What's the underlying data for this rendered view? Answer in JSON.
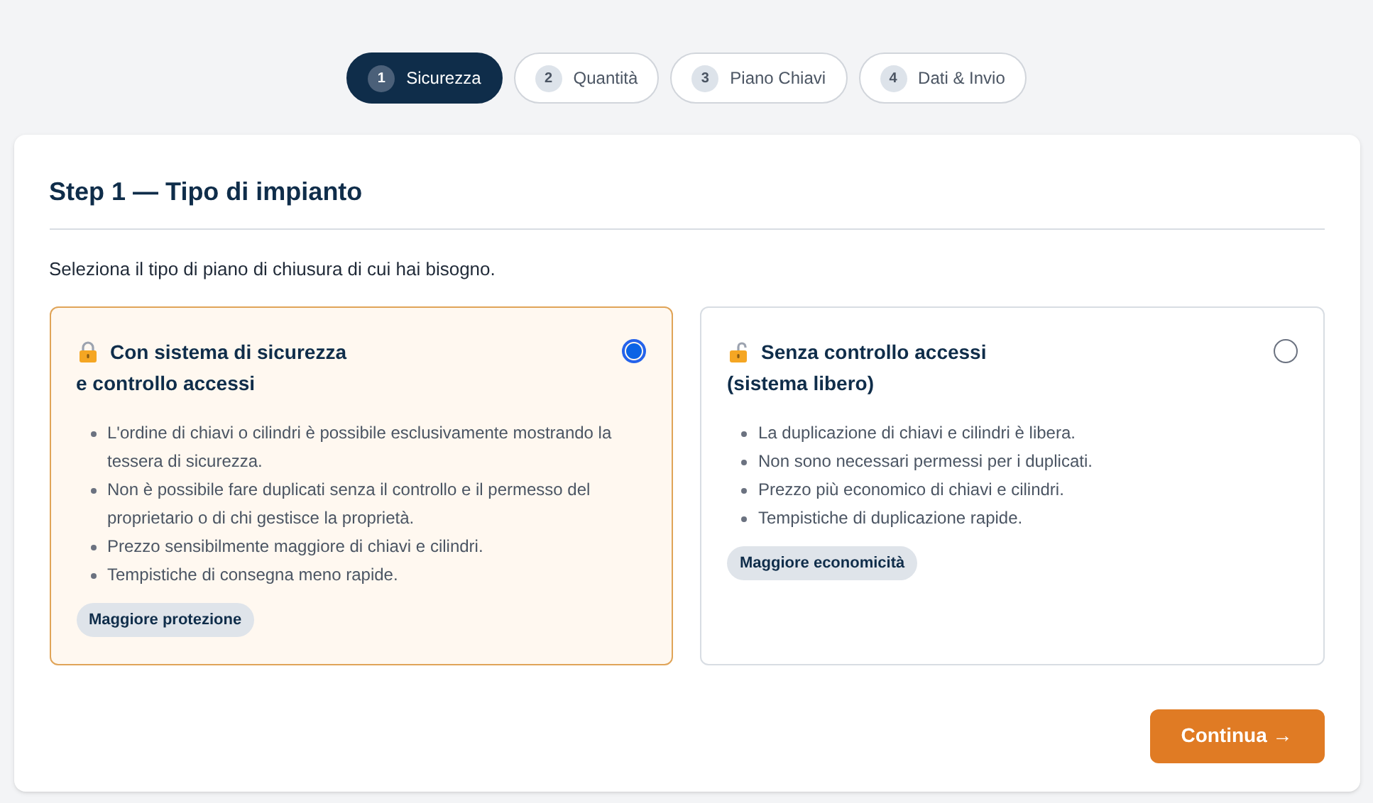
{
  "steps": [
    {
      "number": "1",
      "label": "Sicurezza",
      "selected": true
    },
    {
      "number": "2",
      "label": "Quantità",
      "selected": false
    },
    {
      "number": "3",
      "label": "Piano Chiavi",
      "selected": false
    },
    {
      "number": "4",
      "label": "Dati & Invio",
      "selected": false
    }
  ],
  "card": {
    "title": "Step 1 — Tipo di impianto",
    "intro": "Seleziona il tipo di piano di chiusura di cui hai bisogno.",
    "options": [
      {
        "kind": "locked",
        "title_lines": [
          "Con sistema di sicurezza",
          "e controllo accessi"
        ],
        "selected": true,
        "points": [
          "L'ordine di chiavi o cilindri è possibile esclusivamente mostrando la tessera di sicurezza.",
          "Non è possibile fare duplicati senza il controllo e il permesso del proprietario o di chi gestisce la proprietà.",
          "Prezzo sensibilmente maggiore di chiavi e cilindri.",
          "Tempistiche di consegna meno rapide."
        ],
        "tag": "Maggiore protezione"
      },
      {
        "kind": "unlocked",
        "title_lines": [
          "Senza controllo accessi",
          "(sistema libero)"
        ],
        "selected": false,
        "points": [
          "La duplicazione di chiavi e cilindri è libera.",
          "Non sono necessari permessi per i duplicati.",
          "Prezzo più economico di chiavi e cilindri.",
          "Tempistiche di duplicazione rapide."
        ],
        "tag": "Maggiore economicità"
      }
    ],
    "continue_button": "Continua →"
  }
}
